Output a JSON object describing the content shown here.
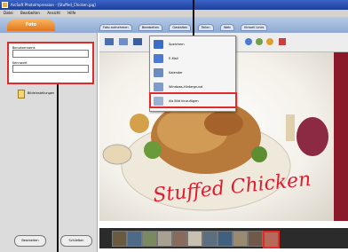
{
  "window": {
    "title": "ArcSoft PhotoImpression - [Stuffed_Chicken.jpg]"
  },
  "menubar": {
    "items": [
      "Datei",
      "Bearbeiten",
      "Ansicht",
      "Hilfe"
    ]
  },
  "tabbar": {
    "active_tab": "Foto",
    "tabs": [
      "Foto aufnehmen",
      "Bearbeiten",
      "Gestalten",
      "Teilen",
      "Web",
      "Virtuell Links"
    ]
  },
  "left_panel": {
    "field1_label": "Benutzername",
    "field2_label": "Kennwort",
    "file_label": "Bildeinstellungen"
  },
  "dropdown": {
    "items": [
      {
        "label": "Speichern",
        "icon": "floppy-disk-icon",
        "color": "#3b6ec9"
      },
      {
        "label": "E-Mail",
        "icon": "envelope-icon",
        "color": "#4a7bd0"
      },
      {
        "label": "Kalender",
        "icon": "calendar-icon",
        "color": "#6b8cc0"
      },
      {
        "label": "Windows-Hintergrund",
        "icon": "monitor-icon",
        "color": "#7d9ccb"
      },
      {
        "label": "Als Bild hinzufügen",
        "icon": "add-picture-icon",
        "color": "#9bb0d4"
      }
    ]
  },
  "canvas": {
    "title_text": "Stuffed Chicken",
    "title_color": "#e11c2e"
  },
  "bottom_buttons": {
    "left": "Bearbeiten",
    "right": "Schließen"
  },
  "colors": {
    "accent_red": "#e12b2b",
    "tab_orange": "#e1741f",
    "tabbar_blue": "#8fa9d2"
  }
}
